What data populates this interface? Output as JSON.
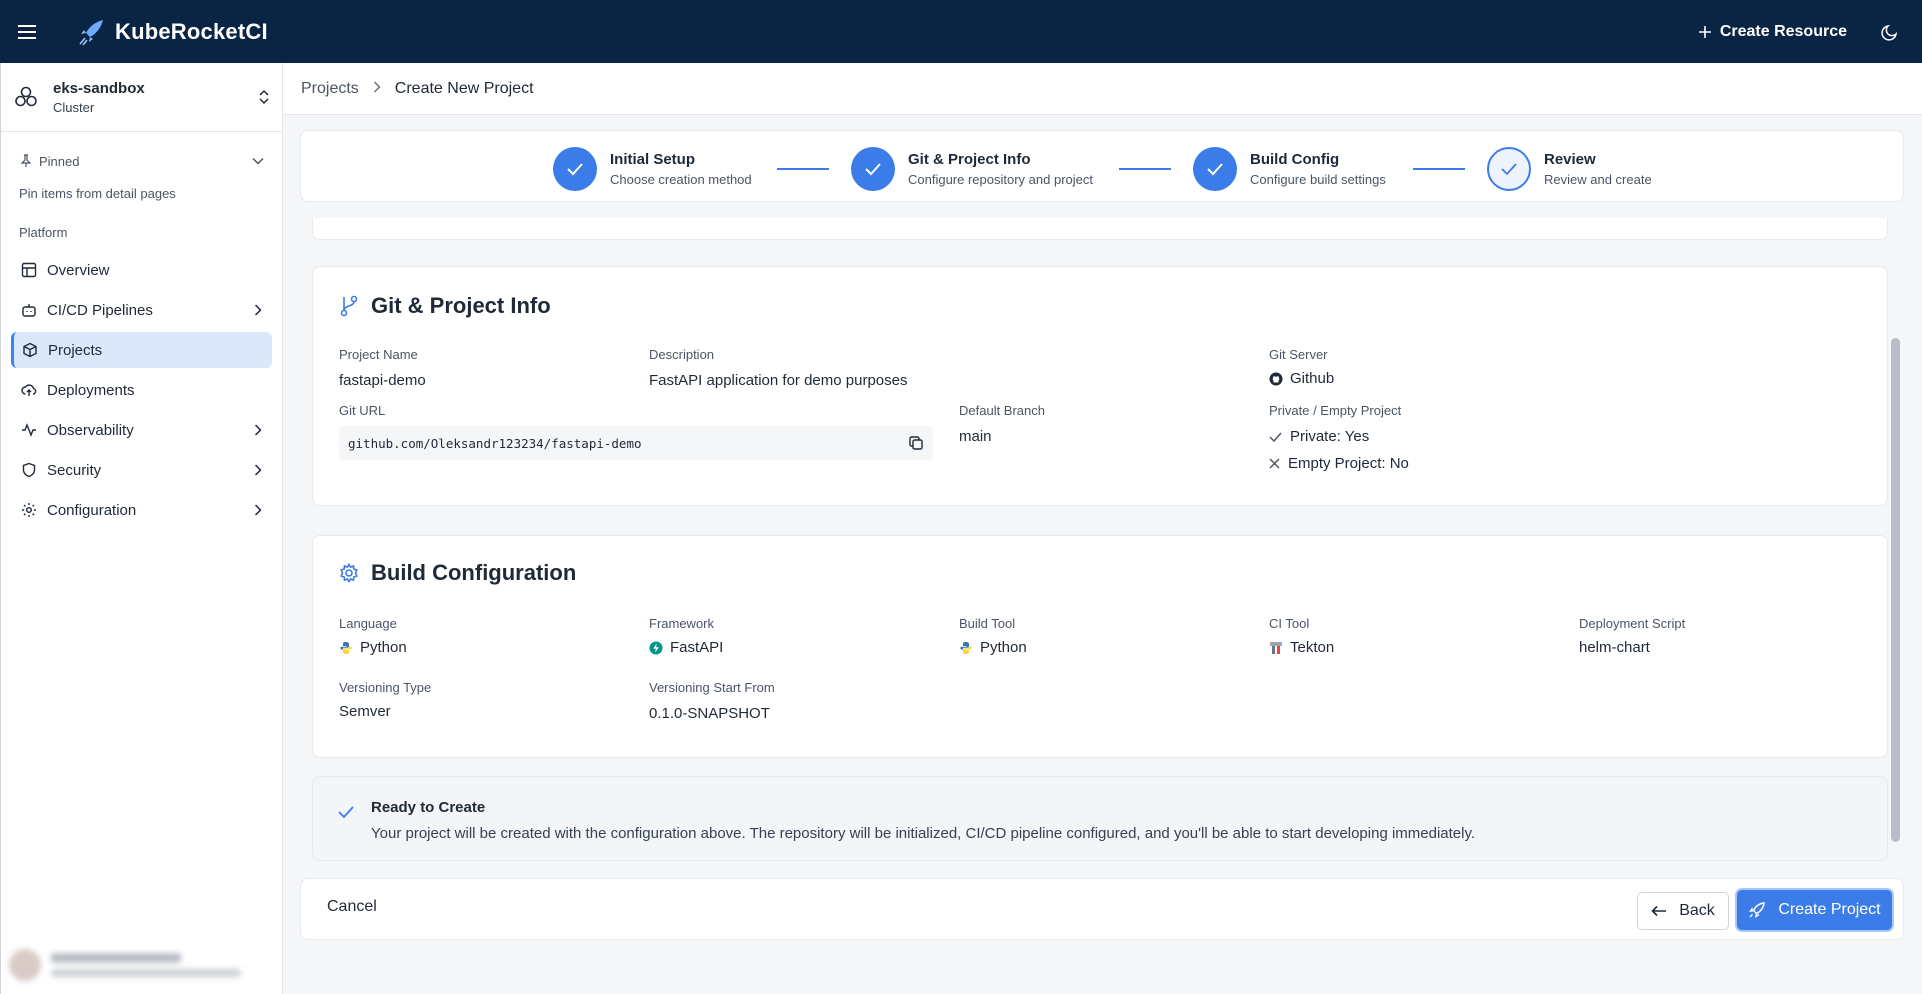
{
  "app": {
    "brand": "KubeRocketCI",
    "create_resource_label": "Create Resource"
  },
  "sidebar": {
    "cluster_name": "eks-sandbox",
    "cluster_type": "Cluster",
    "pinned_label": "Pinned",
    "pinned_hint": "Pin items from detail pages",
    "section_label": "Platform",
    "items": [
      {
        "label": "Overview",
        "icon": "layout-icon",
        "expandable": false
      },
      {
        "label": "CI/CD Pipelines",
        "icon": "bot-icon",
        "expandable": true
      },
      {
        "label": "Projects",
        "icon": "box-icon",
        "expandable": false,
        "active": true
      },
      {
        "label": "Deployments",
        "icon": "cloud-upload-icon",
        "expandable": false
      },
      {
        "label": "Observability",
        "icon": "activity-icon",
        "expandable": true
      },
      {
        "label": "Security",
        "icon": "shield-icon",
        "expandable": true
      },
      {
        "label": "Configuration",
        "icon": "gear-icon",
        "expandable": true
      }
    ]
  },
  "breadcrumb": {
    "parent": "Projects",
    "current": "Create New Project"
  },
  "stepper": {
    "steps": [
      {
        "title": "Initial Setup",
        "subtitle": "Choose creation method",
        "state": "complete"
      },
      {
        "title": "Git & Project Info",
        "subtitle": "Configure repository and project",
        "state": "complete"
      },
      {
        "title": "Build Config",
        "subtitle": "Configure build settings",
        "state": "complete"
      },
      {
        "title": "Review",
        "subtitle": "Review and create",
        "state": "current"
      }
    ]
  },
  "git_info": {
    "title": "Git & Project Info",
    "project_name_label": "Project Name",
    "project_name": "fastapi-demo",
    "description_label": "Description",
    "description": "FastAPI application for demo purposes",
    "git_server_label": "Git Server",
    "git_server": "Github",
    "git_url_label": "Git URL",
    "git_url": "github.com/Oleksandr123234/fastapi-demo",
    "default_branch_label": "Default Branch",
    "default_branch": "main",
    "private_empty_label": "Private / Empty Project",
    "private": "Private: Yes",
    "empty": "Empty Project: No"
  },
  "build_config": {
    "title": "Build Configuration",
    "language_label": "Language",
    "language": "Python",
    "framework_label": "Framework",
    "framework": "FastAPI",
    "build_tool_label": "Build Tool",
    "build_tool": "Python",
    "ci_tool_label": "CI Tool",
    "ci_tool": "Tekton",
    "deployment_script_label": "Deployment Script",
    "deployment_script": "helm-chart",
    "versioning_type_label": "Versioning Type",
    "versioning_type": "Semver",
    "versioning_start_label": "Versioning Start From",
    "versioning_start": "0.1.0-SNAPSHOT"
  },
  "ready": {
    "title": "Ready to Create",
    "body": "Your project will be created with the configuration above. The repository will be initialized, CI/CD pipeline configured, and you'll be able to start developing immediately."
  },
  "footer": {
    "cancel_label": "Cancel",
    "back_label": "Back",
    "create_label": "Create Project"
  },
  "colors": {
    "topbar": "#0a2444",
    "accent": "#3b7ce8",
    "active_nav_bg": "#dbe8fb"
  }
}
